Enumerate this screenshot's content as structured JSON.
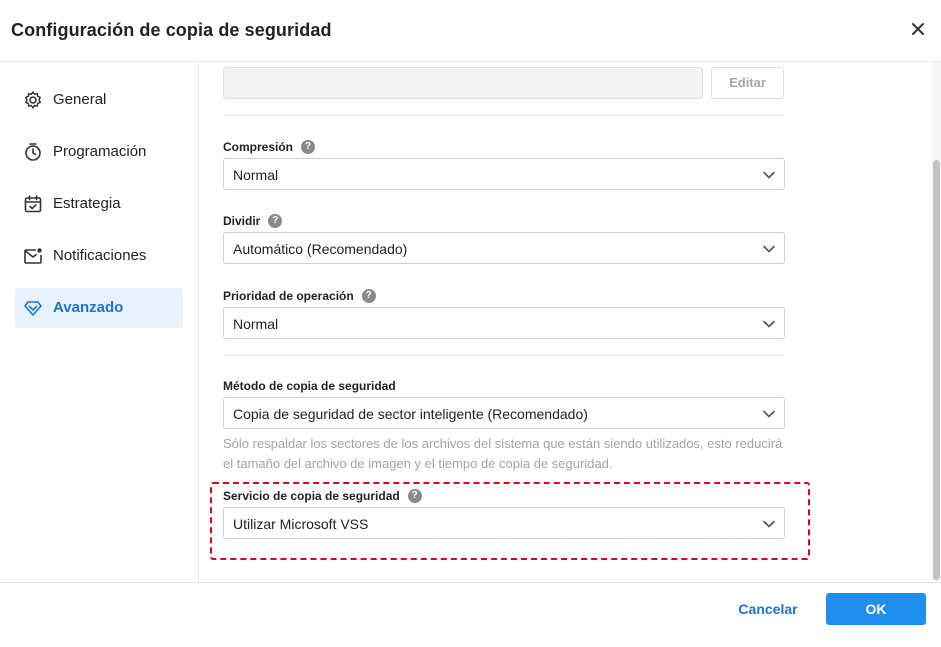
{
  "dialog": {
    "title": "Configuración de copia de seguridad",
    "close_icon": "close-icon"
  },
  "sidebar": {
    "items": [
      {
        "label": "General",
        "icon": "gear-icon",
        "active": false
      },
      {
        "label": "Programación",
        "icon": "timer-icon",
        "active": false
      },
      {
        "label": "Estrategia",
        "icon": "calendar-check-icon",
        "active": false
      },
      {
        "label": "Notificaciones",
        "icon": "mail-notification-icon",
        "active": false
      },
      {
        "label": "Avanzado",
        "icon": "diamond-icon",
        "active": true
      }
    ]
  },
  "content": {
    "top_field": {
      "value": "",
      "edit_label": "Editar"
    },
    "compression": {
      "label": "Compresión",
      "value": "Normal"
    },
    "split": {
      "label": "Dividir",
      "value": "Automático (Recomendado)"
    },
    "priority": {
      "label": "Prioridad de operación",
      "value": "Normal"
    },
    "backup_method": {
      "label": "Método de copia de seguridad",
      "value": "Copia de seguridad de sector inteligente (Recomendado)",
      "hint": "Sólo respaldar los sectores de los archivos del sistema que están siendo utilizados, esto reducirá el tamaño del archivo de imagen y el tiempo de copia de seguridad."
    },
    "backup_service": {
      "label": "Servicio de copia de seguridad",
      "value": "Utilizar Microsoft VSS"
    }
  },
  "footer": {
    "cancel_label": "Cancelar",
    "ok_label": "OK"
  },
  "colors": {
    "accent": "#1f73d6",
    "primary_button": "#1f8ef1",
    "highlight_border": "#d9001b",
    "active_nav_bg": "#e8f2fd"
  }
}
